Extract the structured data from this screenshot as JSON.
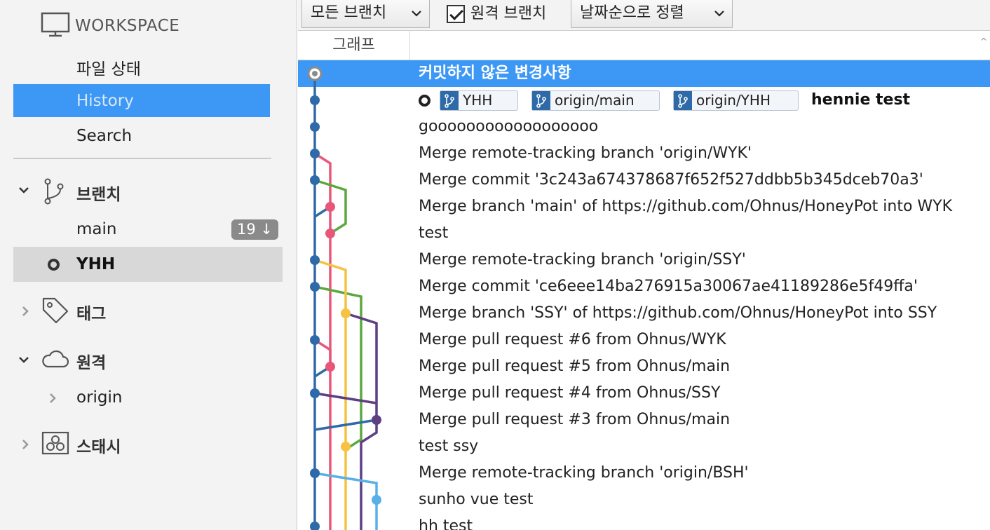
{
  "sidebar": {
    "workspace_title": "WORKSPACE",
    "items": [
      {
        "label": "파일 상태"
      },
      {
        "label": "History"
      },
      {
        "label": "Search"
      }
    ],
    "branches": {
      "title": "브랜치",
      "items": [
        {
          "label": "main",
          "badge": "19 ↓"
        },
        {
          "label": "YHH"
        }
      ]
    },
    "tags": {
      "title": "태그"
    },
    "remotes": {
      "title": "원격",
      "items": [
        {
          "label": "origin"
        }
      ]
    },
    "stashes": {
      "title": "스태시"
    }
  },
  "toolbar": {
    "branch_filter": "모든 브랜치",
    "remote_branches_label": "원격 브랜치",
    "remote_branches_checked": true,
    "sort": "날짜순으로 정렬"
  },
  "columns": {
    "graph": "그래프"
  },
  "commits": [
    {
      "message": "커밋하지 않은 변경사항",
      "selected": true
    },
    {
      "branches": [
        "YHH",
        "origin/main",
        "origin/YHH"
      ],
      "message": "hennie test"
    },
    {
      "message": "goooooooooooooooooo"
    },
    {
      "message": "Merge remote-tracking branch 'origin/WYK'"
    },
    {
      "message": "Merge commit '3c243a674378687f652f527ddbb5b345dceb70a3'"
    },
    {
      "message": "Merge branch 'main' of https://github.com/Ohnus/HoneyPot into WYK"
    },
    {
      "message": "test"
    },
    {
      "message": "Merge remote-tracking branch 'origin/SSY'"
    },
    {
      "message": "Merge commit 'ce6eee14ba276915a30067ae41189286e5f49ffa'"
    },
    {
      "message": "Merge branch 'SSY' of https://github.com/Ohnus/HoneyPot into SSY"
    },
    {
      "message": "Merge pull request #6 from Ohnus/WYK"
    },
    {
      "message": "Merge pull request #5 from Ohnus/main"
    },
    {
      "message": "Merge pull request #4 from Ohnus/SSY"
    },
    {
      "message": "Merge pull request #3 from Ohnus/main"
    },
    {
      "message": "test ssy"
    },
    {
      "message": "Merge remote-tracking branch 'origin/BSH'"
    },
    {
      "message": "sunho vue test"
    },
    {
      "message": "hh test"
    }
  ],
  "colors": {
    "selection": "#3d98f5",
    "lane_blue": "#2f6aa8",
    "lane_pink": "#e8577a",
    "lane_green": "#5aa83e",
    "lane_yellow": "#f5c242",
    "lane_purple": "#5e3f82",
    "lane_lightblue": "#5ab0e6"
  }
}
